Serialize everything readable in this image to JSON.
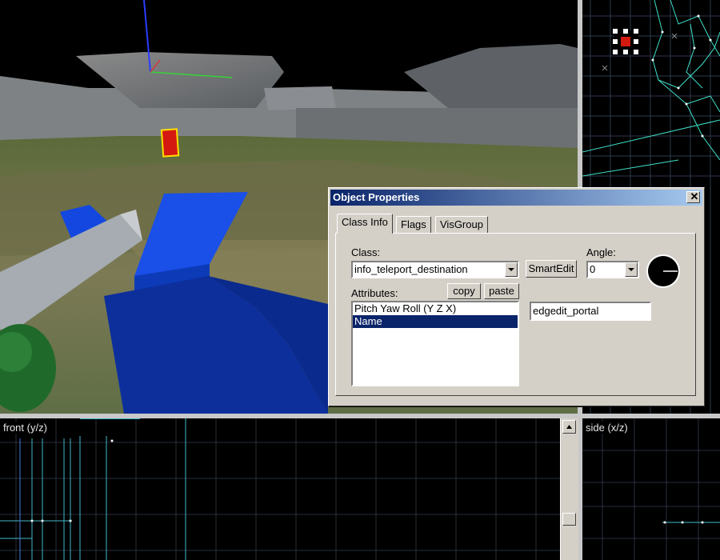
{
  "viewports": {
    "front_label": "front (y/z)",
    "side_label": "side (x/z)"
  },
  "dialog": {
    "title": "Object Properties",
    "close_label": "✕",
    "tabs": [
      "Class Info",
      "Flags",
      "VisGroup"
    ],
    "active_tab": "Class Info",
    "class_label": "Class:",
    "class_value": "info_teleport_destination",
    "smartedit_label": "SmartEdit",
    "angle_label": "Angle:",
    "angle_value": "0",
    "attributes_label": "Attributes:",
    "copy_label": "copy",
    "paste_label": "paste",
    "attributes": [
      "Pitch Yaw Roll (Y Z X)",
      "Name"
    ],
    "selected_attribute": "Name",
    "value_field": "edgedit_portal"
  },
  "colors": {
    "dialog_bg": "#d4d0c8",
    "title_start": "#0a246a",
    "title_end": "#a6caf0",
    "selection": "#0a246a",
    "wire": "#3fe0c8",
    "grid": "#1e2a3a"
  }
}
